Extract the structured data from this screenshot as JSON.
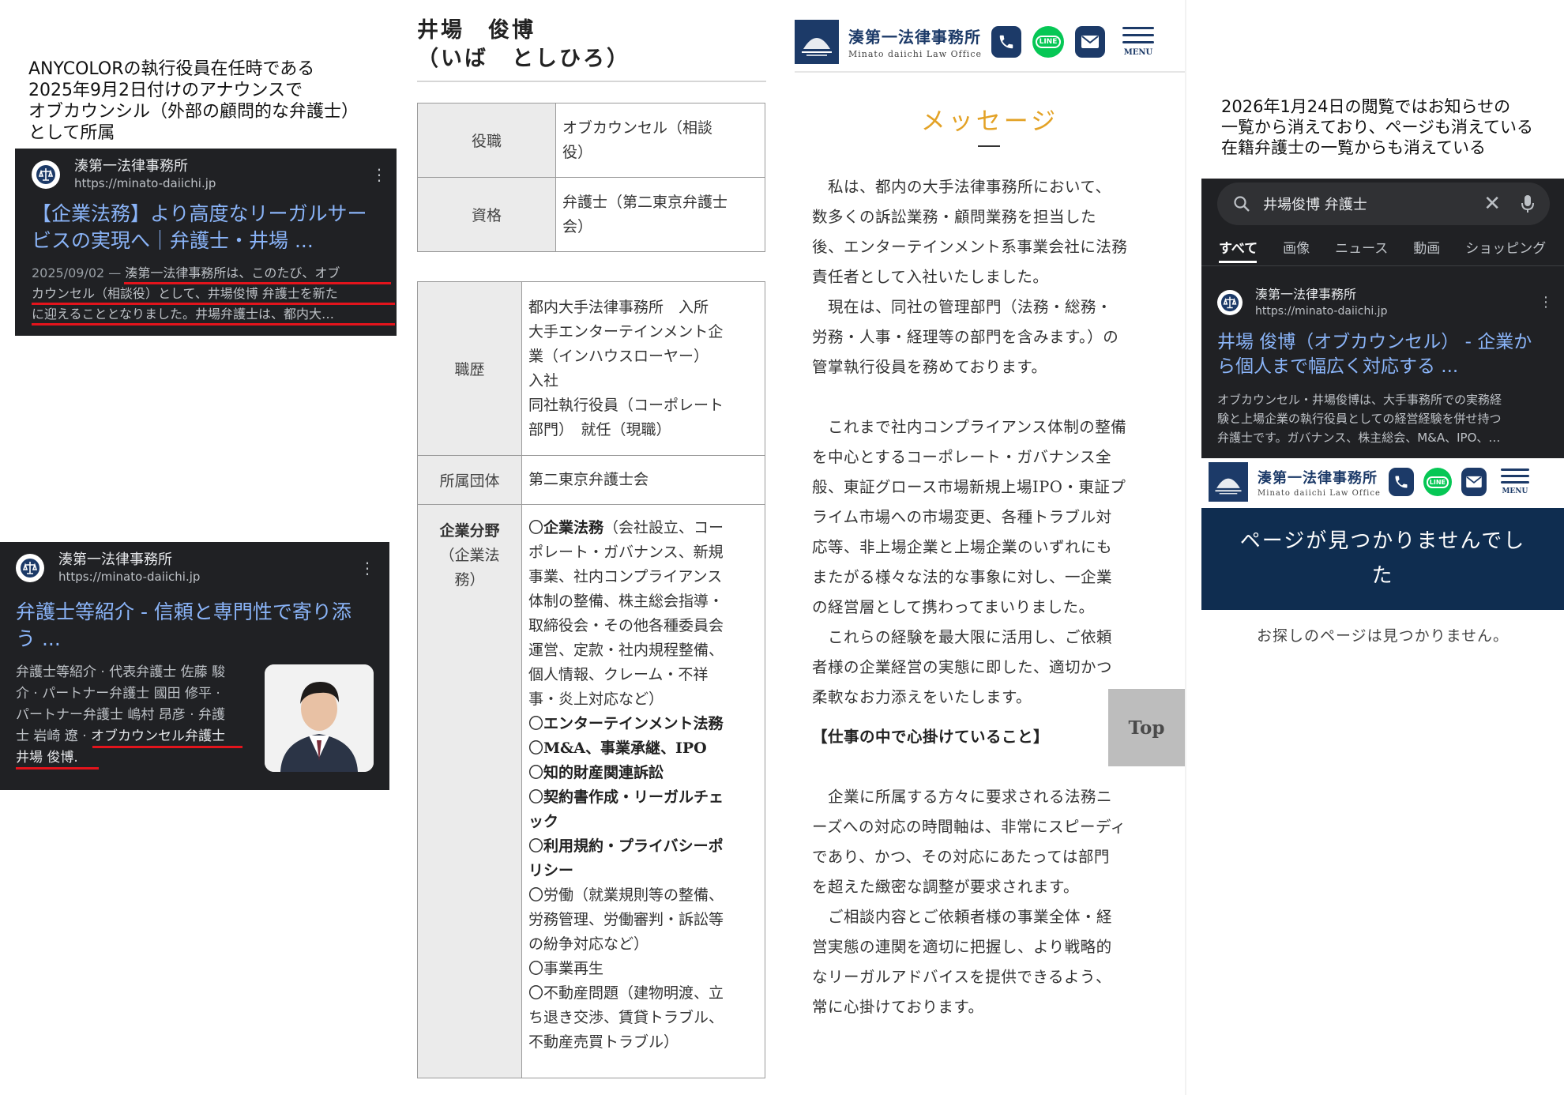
{
  "notes": {
    "announcement": "ANYCOLORの執行役員在任時である\n2025年9月2日付けのアナウンスで\nオブカウンシル（外部の顧問的な弁護士）\nとして所属",
    "removal": "2026年1月24日の閲覧ではお知らせの\n一覧から消えており、ページも消えている\n在籍弁護士の一覧からも消えている"
  },
  "result1": {
    "site_name": "湊第一法律事務所",
    "url": "https://minato-daiichi.jp",
    "title_line1": "【企業法務】より高度なリーガルサー",
    "title_line2": "ビスの実現へ｜弁護士・井場 ...",
    "snippet_date": "2025/09/02 —",
    "snippet_1": " 湊第一法律事務所は、このたび、オブ",
    "snippet_2": "カウンセル（相談役）として、井場俊博 弁護士を新た",
    "snippet_3": "に迎えることとなりました。井場弁護士は、都内大…"
  },
  "result2": {
    "site_name": "湊第一法律事務所",
    "url": "https://minato-daiichi.jp",
    "title_line1": "弁護士等紹介 - 信頼と専門性で寄り添",
    "title_line2": "う ...",
    "snippet_1": "弁護士等紹介 · 代表弁護士 佐藤 駿",
    "snippet_2": "介 · パートナー弁護士 國田 修平 ·",
    "snippet_3": "パートナー弁護士 嶋村 昂彦 · 弁護",
    "snippet_4": "士 岩崎 遼 · ",
    "snippet_4b": "オブカウンセル弁護士",
    "snippet_5": "井場 俊博."
  },
  "profile": {
    "name": "井場　俊博",
    "reading": "（いば　としひろ）",
    "rows1": [
      {
        "label": "役職",
        "value": "オブカウンセル（相談\n役）"
      },
      {
        "label": "資格",
        "value": "弁護士（第二東京弁護士\n会）"
      }
    ],
    "career_label": "職歴",
    "career": "都内大手法律事務所　入所\n大手エンターテインメント企\n業（インハウスローヤー）\n入社\n同社執行役員（コーポレート\n部門）　就任（現職）",
    "org_label": "所属団体",
    "org": "第二東京弁護士会",
    "field_label": "企業分野",
    "field_sub": "（企業法\n務）",
    "fields": [
      {
        "text": "〇",
        "bold": "企業法務",
        "rest": "（会社設立、コー\nポレート・ガバナンス、新規\n事業、社内コンプライアンス\n体制の整備、株主総会指導・\n取締役会・その他各種委員会\n運営、定款・社内規程整備、\n個人情報、クレーム・不祥\n事・炎上対応など）"
      },
      {
        "text": "〇",
        "bold": "エンターテインメント法務",
        "rest": ""
      },
      {
        "text": "〇",
        "bold": "M&A、事業承継、IPO",
        "rest": ""
      },
      {
        "text": "〇",
        "bold": "知的財産関連訴訟",
        "rest": ""
      },
      {
        "text": "〇",
        "bold": "契約書作成・リーガルチェ\nック",
        "rest": ""
      },
      {
        "text": "〇",
        "bold": "利用規約・プライバシーポ\nリシー",
        "rest": ""
      },
      {
        "text": "〇",
        "bold": "",
        "rest": "労働（就業規則等の整備、\n労務管理、労働審判・訴訟等\nの紛争対応など）"
      },
      {
        "text": "〇",
        "bold": "",
        "rest": "事業再生"
      },
      {
        "text": "〇",
        "bold": "",
        "rest": "不動産問題（建物明渡、立\nち退き交渉、賃貸トラブル、\n不動産売買トラブル）"
      }
    ]
  },
  "header": {
    "logo_jp": "湊第一法律事務所",
    "logo_en": "Minato daiichi Law Office",
    "line_label": "LINE",
    "menu_label": "MENU"
  },
  "message": {
    "title": "メッセージ",
    "p1": "　私は、都内の大手法律事務所において、\n数多くの訴訟業務・顧問業務を担当した\n後、エンターテインメント系事業会社に法務\n責任者として入社いたしました。\n　現在は、同社の管理部門（法務・総務・\n労務・人事・経理等の部門を含みます。）の\n管掌執行役員を務めております。",
    "p2": "　これまで社内コンプライアンス体制の整備\nを中心とするコーポレート・ガバナンス全\n般、東証グロース市場新規上場IPO・東証プ\nライム市場への市場変更、各種トラブル対\n応等、非上場企業と上場企業のいずれにも\nまたがる様々な法的な事象に対し、一企業\nの経営層として携わってまいりました。\n　これらの経験を最大限に活用し、ご依頼\n者様の企業経営の実態に即した、適切かつ\n柔軟なお力添えをいたします。",
    "subheading": "【仕事の中で心掛けていること】",
    "p3": "　企業に所属する方々に要求される法務ニ\nーズへの対応の時間軸は、非常にスピーディ\nであり、かつ、その対応にあたっては部門\nを超えた緻密な調整が要求されます。\n　ご相談内容とご依頼者様の事業全体・経\n営実態の連関を適切に把握し、より戦略的\nなリーガルアドバイスを提供できるよう、\n常に心掛けております。",
    "top_button": "Top"
  },
  "search": {
    "query": "井場俊博 弁護士",
    "tabs": [
      "すべて",
      "画像",
      "ニュース",
      "動画",
      "ショッピング"
    ],
    "site_name": "湊第一法律事務所",
    "url": "https://minato-daiichi.jp",
    "title_line1": "井場 俊博（オブカウンセル） - 企業か",
    "title_line2": "ら個人まで幅広く対応する ...",
    "snippet_1": "オブカウンセル・井場俊博は、大手事務所での実務経",
    "snippet_2": "験と上場企業の執行役員としての経営経験を併せ持つ",
    "snippet_3": "弁護士です。ガバナンス、株主総会、M&A、IPO、…"
  },
  "not_found": {
    "title": "ページが見つかりませんでし\nた",
    "text": "お探しのページは見つかりません。"
  },
  "colors": {
    "brand_navy": "#1c3a68",
    "accent_gold": "#e3a226",
    "phone": "#1c3a68",
    "line": "#06c755",
    "underline_red": "#e3141c"
  }
}
